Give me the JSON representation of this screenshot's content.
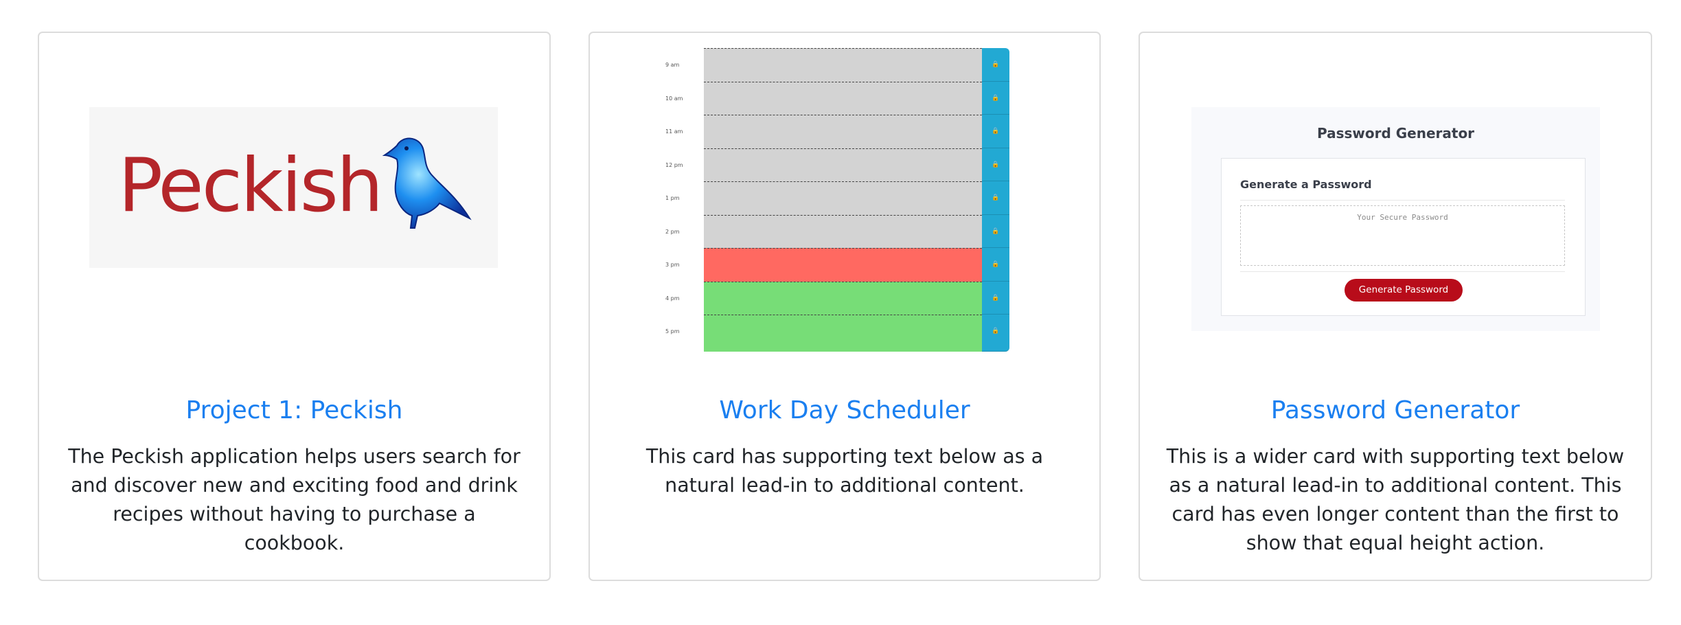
{
  "cards": [
    {
      "title": "Project 1: Peckish",
      "text": "The Peckish application helps users search for and discover new and exciting food and drink recipes without having to purchase a cookbook.",
      "image": {
        "logo_text": "Peckish",
        "icon": "blue-bird-icon"
      }
    },
    {
      "title": "Work Day Scheduler",
      "text": "This card has supporting text below as a natural lead-in to additional content.",
      "image": {
        "hours": [
          "9 am",
          "10 am",
          "11 am",
          "12 pm",
          "1 pm",
          "2 pm",
          "3 pm",
          "4 pm",
          "5 pm"
        ],
        "slot_states": [
          "past",
          "past",
          "past",
          "past",
          "past",
          "past",
          "present",
          "future",
          "future"
        ],
        "state_colors": {
          "past": "#d3d3d3",
          "present": "#ff6961",
          "future": "#77dd77"
        },
        "lock_color": "#22a9d3",
        "lock_icon": "lock-icon"
      }
    },
    {
      "title": "Password Generator",
      "text": "This is a wider card with supporting text below as a natural lead-in to additional content. This card has even longer content than the first to show that equal height action.",
      "image": {
        "header": "Password Generator",
        "inner_title": "Generate a Password",
        "placeholder": "Your Secure Password",
        "button_label": "Generate Password"
      }
    }
  ],
  "colors": {
    "title": "#1a7ff0",
    "text": "#212529",
    "border": "#dcdcdc"
  }
}
